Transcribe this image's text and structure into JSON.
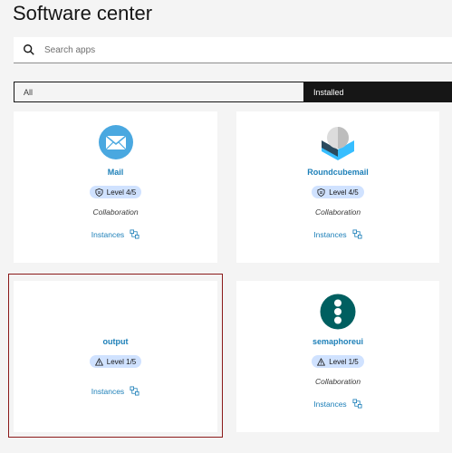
{
  "page": {
    "title": "Software center"
  },
  "search": {
    "placeholder": "Search apps",
    "icon": "search-icon"
  },
  "tabs": [
    {
      "label": "All",
      "selected": false
    },
    {
      "label": "Installed",
      "selected": true
    }
  ],
  "apps": [
    {
      "name": "Mail",
      "level": "Level 4/5",
      "level_icon": "shield-icon",
      "category": "Collaboration",
      "instances_label": "Instances",
      "logo": "mail-icon",
      "logo_color": "#4aa8e0"
    },
    {
      "name": "Roundcubemail",
      "level": "Level 4/5",
      "level_icon": "shield-icon",
      "category": "Collaboration",
      "instances_label": "Instances",
      "logo": "roundcube-icon",
      "logo_color": "#37beff"
    },
    {
      "name": "output",
      "level": "Level 1/5",
      "level_icon": "warning-icon",
      "category": "",
      "instances_label": "Instances",
      "logo": "",
      "logo_color": ""
    },
    {
      "name": "semaphoreui",
      "level": "Level 1/5",
      "level_icon": "warning-icon",
      "category": "Collaboration",
      "instances_label": "Instances",
      "logo": "semaphore-icon",
      "logo_color": "#005f60"
    }
  ],
  "colors": {
    "accent_link": "#1c7fb8",
    "badge_bg": "#d0e2ff",
    "highlight_border": "#8b1a1a",
    "tab_active_bg": "#161616"
  }
}
